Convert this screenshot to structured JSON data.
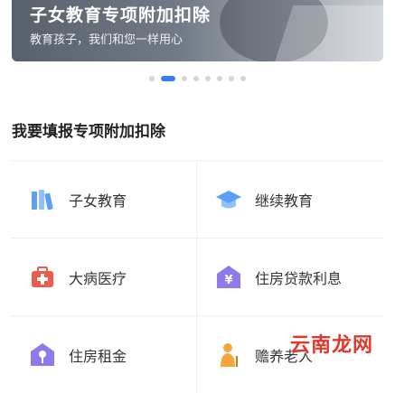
{
  "banner": {
    "title": "子女教育专项附加扣除",
    "subtitle": "教育孩子，我们和您一样用心"
  },
  "carousel": {
    "count": 8,
    "active_index": 1
  },
  "section": {
    "title": "我要填报专项附加扣除"
  },
  "items": [
    {
      "label": "子女教育",
      "icon": "books-icon"
    },
    {
      "label": "继续教育",
      "icon": "graduation-cap-icon"
    },
    {
      "label": "大病医疗",
      "icon": "medical-kit-icon"
    },
    {
      "label": "住房贷款利息",
      "icon": "house-loan-icon"
    },
    {
      "label": "住房租金",
      "icon": "house-key-icon"
    },
    {
      "label": "赡养老人",
      "icon": "elderly-icon"
    }
  ],
  "watermark": "云南龙网",
  "colors": {
    "accent": "#3a7bf0",
    "icon_blue": "#5b9ef5",
    "icon_red": "#ee5a4c",
    "icon_purple": "#8c7be8",
    "icon_orange": "#f5a53a"
  }
}
